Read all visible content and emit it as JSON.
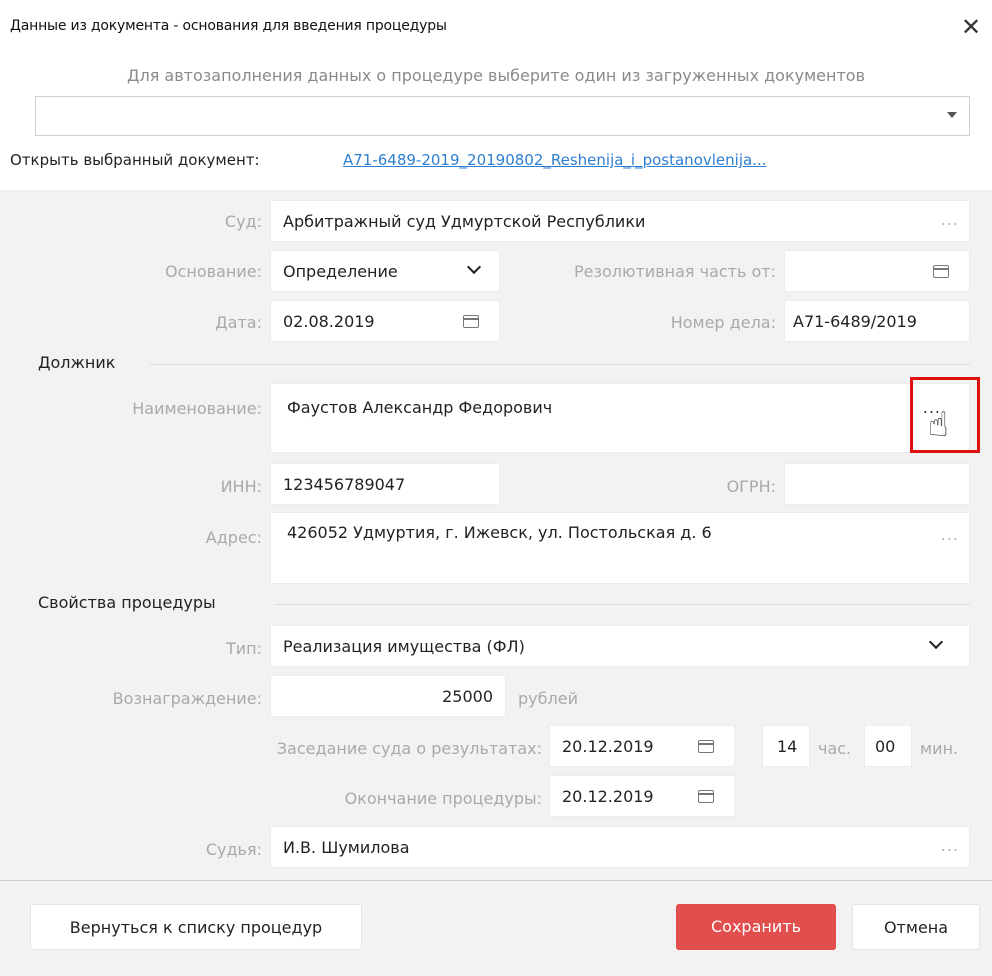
{
  "dialog": {
    "title": "Данные из документа - основания для введения процедуры",
    "close_icon": "close-icon"
  },
  "autofill": {
    "hint": "Для автозаполнения данных о процедуре выберите один из загруженных документов",
    "selected_value": ""
  },
  "open_doc": {
    "label": "Открыть выбранный документ:",
    "link": "A71-6489-2019_20190802_Reshenija_i_postanovlenija..."
  },
  "court": {
    "label": "Суд:",
    "value": "Арбитражный суд Удмуртской Республики",
    "dots": "..."
  },
  "basis": {
    "label": "Основание:",
    "value": "Определение",
    "resolution_label": "Резолютивная часть от:",
    "resolution_value": ""
  },
  "date": {
    "label": "Дата:",
    "value": "02.08.2019",
    "case_label": "Номер дела:",
    "case_value": "А71-6489/2019"
  },
  "debtor": {
    "section": "Должник",
    "name_label": "Наименование:",
    "name_value": "Фаустов Александр Федорович",
    "dots": "...",
    "inn_label": "ИНН:",
    "inn_value": "123456789047",
    "ogrn_label": "ОГРН:",
    "ogrn_value": "",
    "address_label": "Адрес:",
    "address_value": "426052 Удмуртия,  г. Ижевск,  ул. Постольская д. 6",
    "address_dots": "..."
  },
  "procedure": {
    "section": "Свойства процедуры",
    "type_label": "Тип:",
    "type_value": "Реализация имущества (ФЛ)",
    "reward_label": "Вознаграждение:",
    "reward_value": "25000",
    "reward_unit": "рублей",
    "hearing_label": "Заседание суда о результатах:",
    "hearing_date": "20.12.2019",
    "hearing_hour": "14",
    "hour_unit": "час.",
    "hearing_min": "00",
    "min_unit": "мин.",
    "end_label": "Окончание процедуры:",
    "end_date": "20.12.2019",
    "judge_label": "Судья:",
    "judge_value": "И.В. Шумилова",
    "judge_dots": "..."
  },
  "buttons": {
    "back": "Вернуться к списку процедур",
    "save": "Сохранить",
    "cancel": "Отмена"
  },
  "colors": {
    "save_button": "#e24d4d",
    "link": "#2f7fd1",
    "highlight": "#e01010"
  }
}
